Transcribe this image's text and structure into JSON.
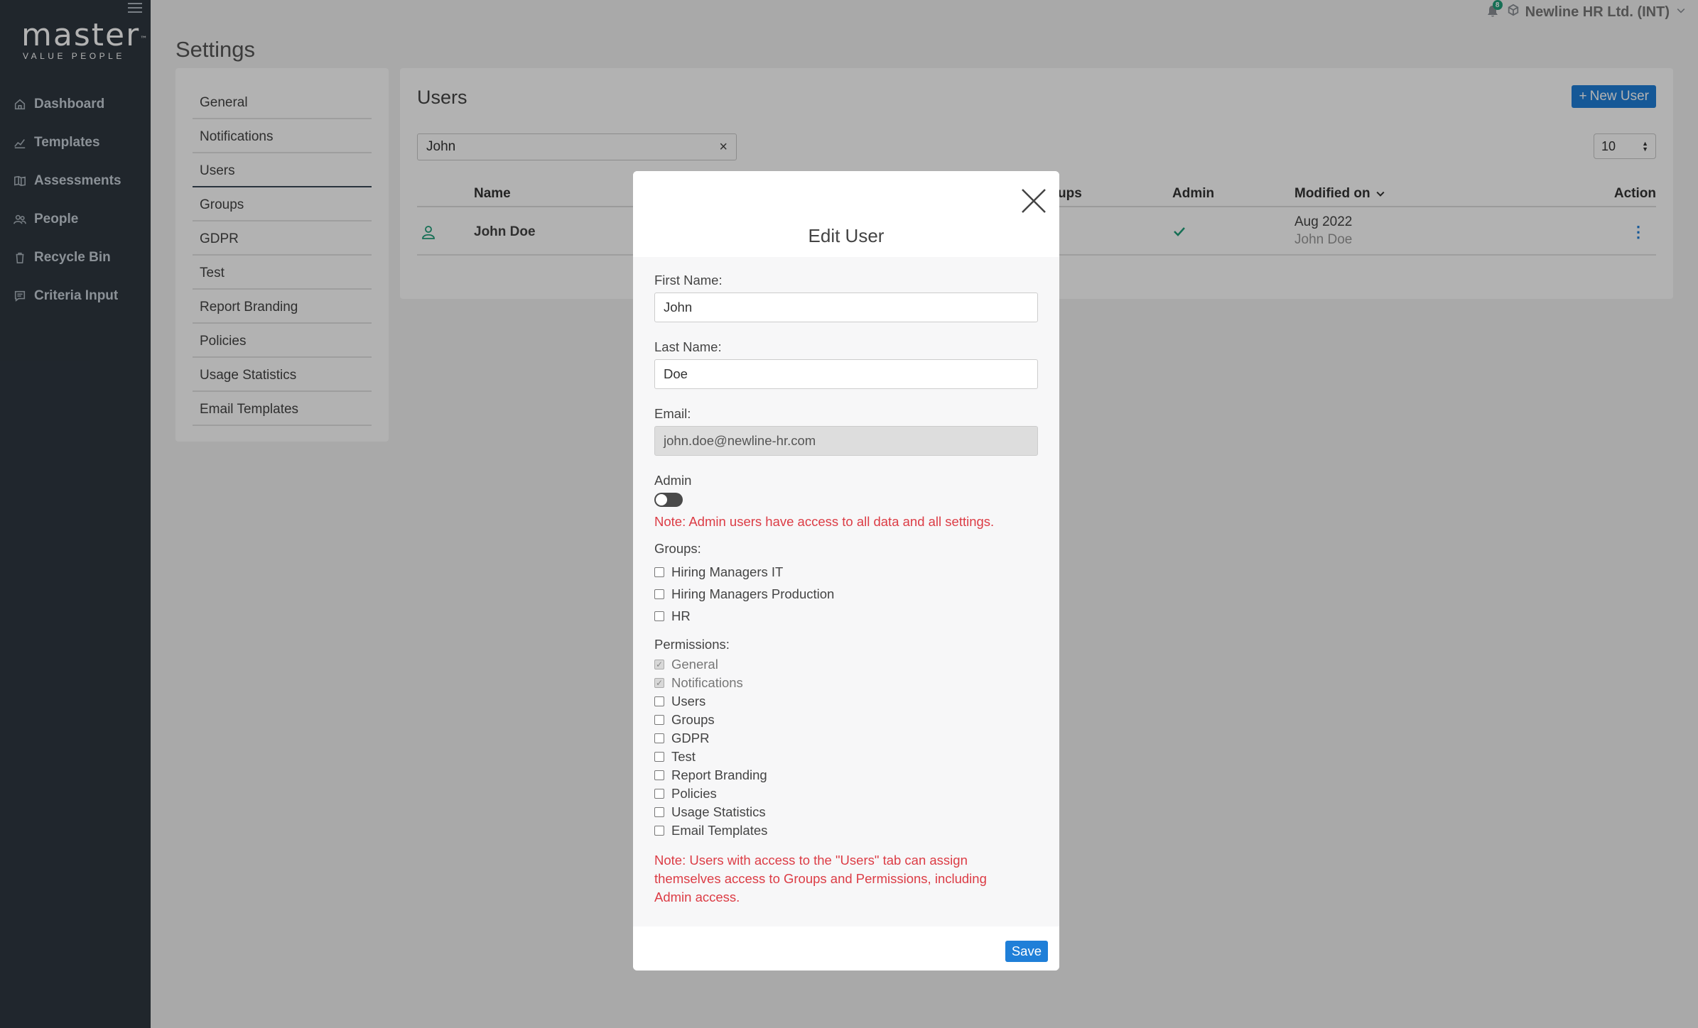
{
  "brand": {
    "name": "master",
    "tagline": "VALUE PEOPLE",
    "tm": "™"
  },
  "sidebar": {
    "items": [
      {
        "label": "Dashboard",
        "icon": "home-icon"
      },
      {
        "label": "Templates",
        "icon": "chart-icon"
      },
      {
        "label": "Assessments",
        "icon": "book-icon"
      },
      {
        "label": "People",
        "icon": "people-icon"
      },
      {
        "label": "Recycle Bin",
        "icon": "trash-icon"
      },
      {
        "label": "Criteria Input",
        "icon": "comment-icon"
      }
    ]
  },
  "topbar": {
    "notification_count": "8",
    "org": "Newline HR Ltd. (INT)"
  },
  "page": {
    "title": "Settings"
  },
  "settings_menu": {
    "items": [
      "General",
      "Notifications",
      "Users",
      "Groups",
      "GDPR",
      "Test",
      "Report Branding",
      "Policies",
      "Usage Statistics",
      "Email Templates"
    ],
    "active": "Users"
  },
  "users": {
    "title": "Users",
    "new_user_label": "New User",
    "search_value": "John",
    "page_size": "10",
    "columns": {
      "name": "Name",
      "groups": "ups",
      "admin": "Admin",
      "modified": "Modified on",
      "action": "Action"
    },
    "rows": [
      {
        "name": "John Doe",
        "modified_date": "Aug 2022",
        "modified_by": "John Doe",
        "admin": true
      }
    ]
  },
  "modal": {
    "title": "Edit User",
    "first_name_label": "First Name:",
    "first_name_value": "John",
    "last_name_label": "Last Name:",
    "last_name_value": "Doe",
    "email_label": "Email:",
    "email_value": "john.doe@newline-hr.com",
    "admin_label": "Admin",
    "admin_enabled": false,
    "admin_note": "Note: Admin users have access to all data and all settings.",
    "groups_label": "Groups:",
    "groups": [
      {
        "label": "Hiring Managers IT",
        "checked": false
      },
      {
        "label": "Hiring Managers Production",
        "checked": false
      },
      {
        "label": "HR",
        "checked": false
      }
    ],
    "permissions_label": "Permissions:",
    "permissions": [
      {
        "label": "General",
        "checked": true,
        "disabled": true
      },
      {
        "label": "Notifications",
        "checked": true,
        "disabled": true
      },
      {
        "label": "Users",
        "checked": false
      },
      {
        "label": "Groups",
        "checked": false
      },
      {
        "label": "GDPR",
        "checked": false
      },
      {
        "label": "Test",
        "checked": false
      },
      {
        "label": "Report Branding",
        "checked": false
      },
      {
        "label": "Policies",
        "checked": false
      },
      {
        "label": "Usage Statistics",
        "checked": false
      },
      {
        "label": "Email Templates",
        "checked": false
      }
    ],
    "users_note": "Note: Users with access to the \"Users\" tab can assign themselves access to Groups and Permissions, including Admin access.",
    "save_label": "Save"
  },
  "colors": {
    "sidebar_bg": "#2e3740",
    "accent": "#1f7fd8",
    "note_red": "#dc3c45",
    "admin_check": "#20a07a"
  }
}
